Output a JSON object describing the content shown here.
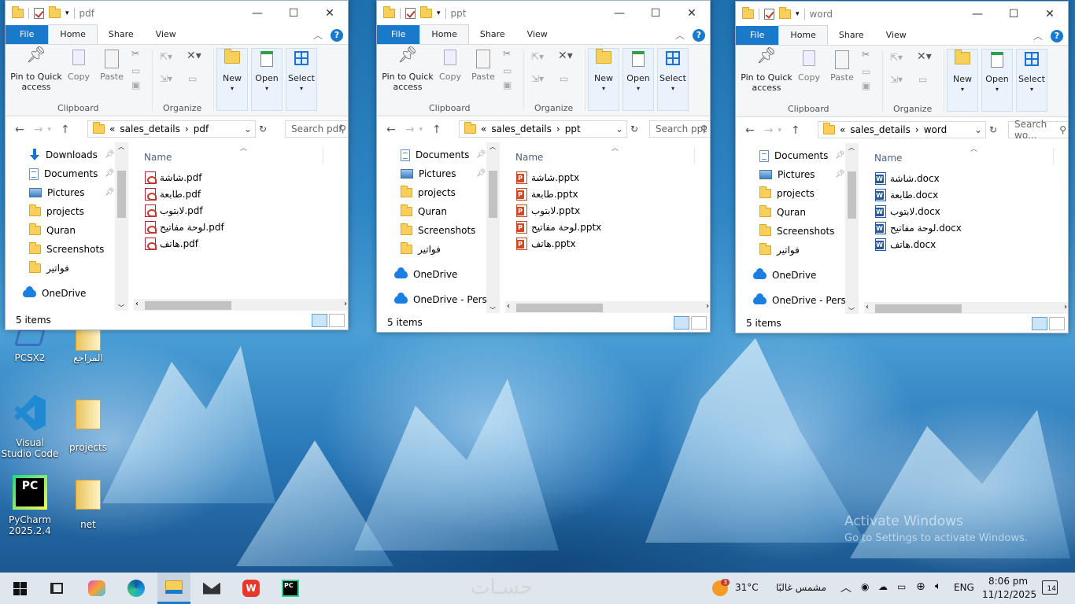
{
  "windows": [
    {
      "id": "pdf",
      "title": "pdf",
      "tabs": [
        "File",
        "Home",
        "Share",
        "View"
      ],
      "ribbon": {
        "pin_label": "Pin to Quick access",
        "copy_label": "Copy",
        "paste_label": "Paste",
        "new_label": "New",
        "open_label": "Open",
        "select_label": "Select",
        "group_clipboard": "Clipboard",
        "group_organize": "Organize"
      },
      "address": {
        "prefix": "«",
        "crumbs": [
          "sales_details",
          "pdf"
        ]
      },
      "search_placeholder": "Search pdf",
      "nav": [
        {
          "label": "Downloads",
          "icon": "download-icon",
          "pinned": true
        },
        {
          "label": "Documents",
          "icon": "document-icon",
          "pinned": true
        },
        {
          "label": "Pictures",
          "icon": "pictures-icon",
          "pinned": true
        },
        {
          "label": "projects",
          "icon": "folder-icon",
          "pinned": false
        },
        {
          "label": "Quran",
          "icon": "folder-icon",
          "pinned": false
        },
        {
          "label": "Screenshots",
          "icon": "folder-icon",
          "pinned": false
        },
        {
          "label": "فواتير",
          "icon": "folder-icon",
          "pinned": false
        },
        {
          "label": "OneDrive",
          "icon": "onedrive-icon",
          "pinned": false
        }
      ],
      "column": "Name",
      "files": [
        "شاشة.pdf",
        "طابعة.pdf",
        "لابتوب.pdf",
        "لوحة مفاتيح.pdf",
        "هاتف.pdf"
      ],
      "file_icon": "pdf-icon",
      "status": "5 items"
    },
    {
      "id": "ppt",
      "title": "ppt",
      "tabs": [
        "File",
        "Home",
        "Share",
        "View"
      ],
      "ribbon": {
        "pin_label": "Pin to Quick access",
        "copy_label": "Copy",
        "paste_label": "Paste",
        "new_label": "New",
        "open_label": "Open",
        "select_label": "Select",
        "group_clipboard": "Clipboard",
        "group_organize": "Organize"
      },
      "address": {
        "prefix": "«",
        "crumbs": [
          "sales_details",
          "ppt"
        ]
      },
      "search_placeholder": "Search ppt",
      "nav": [
        {
          "label": "Documents",
          "icon": "document-icon",
          "pinned": true
        },
        {
          "label": "Pictures",
          "icon": "pictures-icon",
          "pinned": true
        },
        {
          "label": "projects",
          "icon": "folder-icon",
          "pinned": false
        },
        {
          "label": "Quran",
          "icon": "folder-icon",
          "pinned": false
        },
        {
          "label": "Screenshots",
          "icon": "folder-icon",
          "pinned": false
        },
        {
          "label": "فواتير",
          "icon": "folder-icon",
          "pinned": false
        },
        {
          "label": "OneDrive",
          "icon": "onedrive-icon",
          "pinned": false
        },
        {
          "label": "OneDrive - Persor",
          "icon": "onedrive-icon",
          "pinned": false
        }
      ],
      "column": "Name",
      "files": [
        "شاشة.pptx",
        "طابعة.pptx",
        "لابتوب.pptx",
        "لوحة مفاتيح.pptx",
        "هاتف.pptx"
      ],
      "file_icon": "pptx-icon",
      "status": "5 items"
    },
    {
      "id": "word",
      "title": "word",
      "tabs": [
        "File",
        "Home",
        "Share",
        "View"
      ],
      "ribbon": {
        "pin_label": "Pin to Quick access",
        "copy_label": "Copy",
        "paste_label": "Paste",
        "new_label": "New",
        "open_label": "Open",
        "select_label": "Select",
        "group_clipboard": "Clipboard",
        "group_organize": "Organize"
      },
      "address": {
        "prefix": "«",
        "crumbs": [
          "sales_details",
          "word"
        ]
      },
      "search_placeholder": "Search wo...",
      "nav": [
        {
          "label": "Documents",
          "icon": "document-icon",
          "pinned": true
        },
        {
          "label": "Pictures",
          "icon": "pictures-icon",
          "pinned": true
        },
        {
          "label": "projects",
          "icon": "folder-icon",
          "pinned": false
        },
        {
          "label": "Quran",
          "icon": "folder-icon",
          "pinned": false
        },
        {
          "label": "Screenshots",
          "icon": "folder-icon",
          "pinned": false
        },
        {
          "label": "فواتير",
          "icon": "folder-icon",
          "pinned": false
        },
        {
          "label": "OneDrive",
          "icon": "onedrive-icon",
          "pinned": false
        },
        {
          "label": "OneDrive - Persor",
          "icon": "onedrive-icon",
          "pinned": false
        }
      ],
      "column": "Name",
      "files": [
        "شاشة.docx",
        "طابعة.docx",
        "لابتوب.docx",
        "لوحة مفاتيح.docx",
        "هاتف.docx"
      ],
      "file_icon": "docx-icon",
      "status": "5 items"
    }
  ],
  "desktop_icons": [
    {
      "label": "PCSX2",
      "icon": "pcsx2-icon"
    },
    {
      "label": "المراجع",
      "icon": "folder-icon"
    },
    {
      "label": "Visual Studio Code",
      "icon": "vscode-icon"
    },
    {
      "label": "projects",
      "icon": "folder-icon"
    },
    {
      "label": "PyCharm 2025.2.4",
      "icon": "pycharm-icon"
    },
    {
      "label": "net",
      "icon": "folder-icon"
    }
  ],
  "activation": {
    "line1": "Activate Windows",
    "line2": "Go to Settings to activate Windows."
  },
  "taskbar": {
    "weather_temp": "31°C",
    "weather_desc": "مشمس غالبًا",
    "weather_badge": "3",
    "lang": "ENG",
    "time": "8:06 pm",
    "date": "11/12/2025",
    "notif_count": "14",
    "apps": [
      "start-icon",
      "task-view-icon",
      "copilot-icon",
      "edge-icon",
      "file-explorer-icon",
      "mail-icon",
      "wps-icon",
      "pycharm-icon"
    ]
  },
  "colors": {
    "accent": "#1979ca",
    "taskbar": "#dfe6ee"
  }
}
